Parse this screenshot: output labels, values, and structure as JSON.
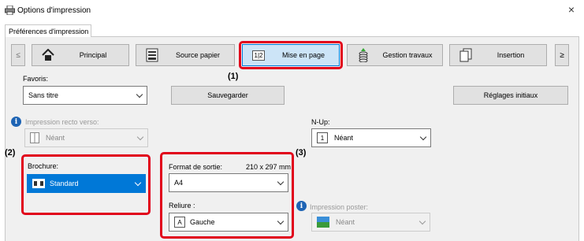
{
  "window": {
    "title": "Options d'impression",
    "close_glyph": "×"
  },
  "tab": {
    "label": "Préférences d'impression"
  },
  "toolbar": {
    "prev": "≤",
    "next": "≥",
    "tabs": [
      {
        "label": "Principal",
        "icon": "home-icon"
      },
      {
        "label": "Source papier",
        "icon": "printer-icon"
      },
      {
        "label": "Mise en page",
        "icon": "layout-icon",
        "icon_text": "1|2"
      },
      {
        "label": "Gestion travaux",
        "icon": "coins-icon"
      },
      {
        "label": "Insertion",
        "icon": "pages-icon"
      }
    ]
  },
  "favorites": {
    "label": "Favoris:",
    "value": "Sans titre",
    "save_label": "Sauvegarder",
    "reset_label": "Réglages initiaux"
  },
  "callouts": {
    "c1": "(1)",
    "c2": "(2)",
    "c3": "(3)"
  },
  "duplex": {
    "label": "Impression recto verso:",
    "value": "Néant"
  },
  "nup": {
    "label": "N-Up:",
    "value": "Néant",
    "icon_text": "1"
  },
  "brochure": {
    "label": "Brochure:",
    "value": "Standard"
  },
  "output": {
    "label": "Format de sortie:",
    "size": "210 x 297 mm",
    "value": "A4"
  },
  "binding": {
    "label": "Reliure :",
    "value": "Gauche",
    "icon_text": "A"
  },
  "poster": {
    "label": "Impression poster:",
    "value": "Néant"
  },
  "colors": {
    "accent": "#0078d7",
    "callout": "#e1001b",
    "info": "#1e64b4"
  }
}
